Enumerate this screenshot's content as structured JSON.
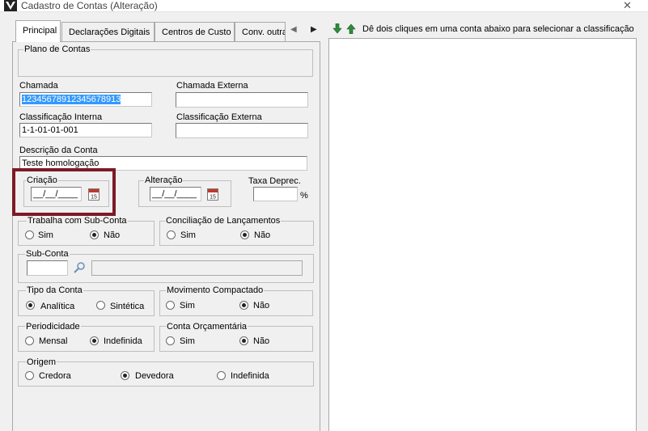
{
  "window": {
    "title": "Cadastro de Contas (Alteração)"
  },
  "tabs": [
    "Principal",
    "Declarações Digitais",
    "Centros de Custo",
    "Conv. outra"
  ],
  "plano": {
    "legend": "Plano de Contas"
  },
  "chamada": {
    "label": "Chamada",
    "value": "12345678912345678913"
  },
  "chamada_externa": {
    "label": "Chamada Externa",
    "value": ""
  },
  "class_interna": {
    "label": "Classificação Interna",
    "value": "1-1-01-01-001"
  },
  "class_externa": {
    "label": "Classificação Externa",
    "value": ""
  },
  "descricao": {
    "label": "Descrição da Conta",
    "value": "Teste homologação"
  },
  "criacao": {
    "label": "Criação",
    "value": "__/__/____",
    "cal_day": "15"
  },
  "alteracao": {
    "label": "Alteração",
    "value": "__/__/____",
    "cal_day": "15"
  },
  "taxa": {
    "label": "Taxa Deprec.",
    "value": "",
    "unit": "%"
  },
  "subconta_flag": {
    "legend": "Trabalha com Sub-Conta",
    "opt1": "Sim",
    "opt2": "Não",
    "selected": "Não"
  },
  "conciliacao": {
    "legend": "Conciliação de Lançamentos",
    "opt1": "Sim",
    "opt2": "Não",
    "selected": "Não"
  },
  "subconta": {
    "legend": "Sub-Conta",
    "code": "",
    "desc": ""
  },
  "tipo": {
    "legend": "Tipo da Conta",
    "opt1": "Analítica",
    "opt2": "Sintética",
    "selected": "Analítica"
  },
  "movimento": {
    "legend": "Movimento Compactado",
    "opt1": "Sim",
    "opt2": "Não",
    "selected": "Não"
  },
  "periodicidade": {
    "legend": "Periodicidade",
    "opt1": "Mensal",
    "opt2": "Indefinida",
    "selected": "Indefinida"
  },
  "orcamentaria": {
    "legend": "Conta Orçamentária",
    "opt1": "Sim",
    "opt2": "Não",
    "selected": "Não"
  },
  "origem": {
    "legend": "Origem",
    "opt1": "Credora",
    "opt2": "Devedora",
    "opt3": "Indefinida",
    "selected": "Devedora"
  },
  "classificacao_panel": {
    "hint": "Dê dois cliques em uma conta abaixo para selecionar a classificação"
  },
  "colors": {
    "highlight": "#7c1b25",
    "arrow_down": "#2e8b3a",
    "arrow_up": "#2e8b3a",
    "selection": "#3399ff"
  }
}
